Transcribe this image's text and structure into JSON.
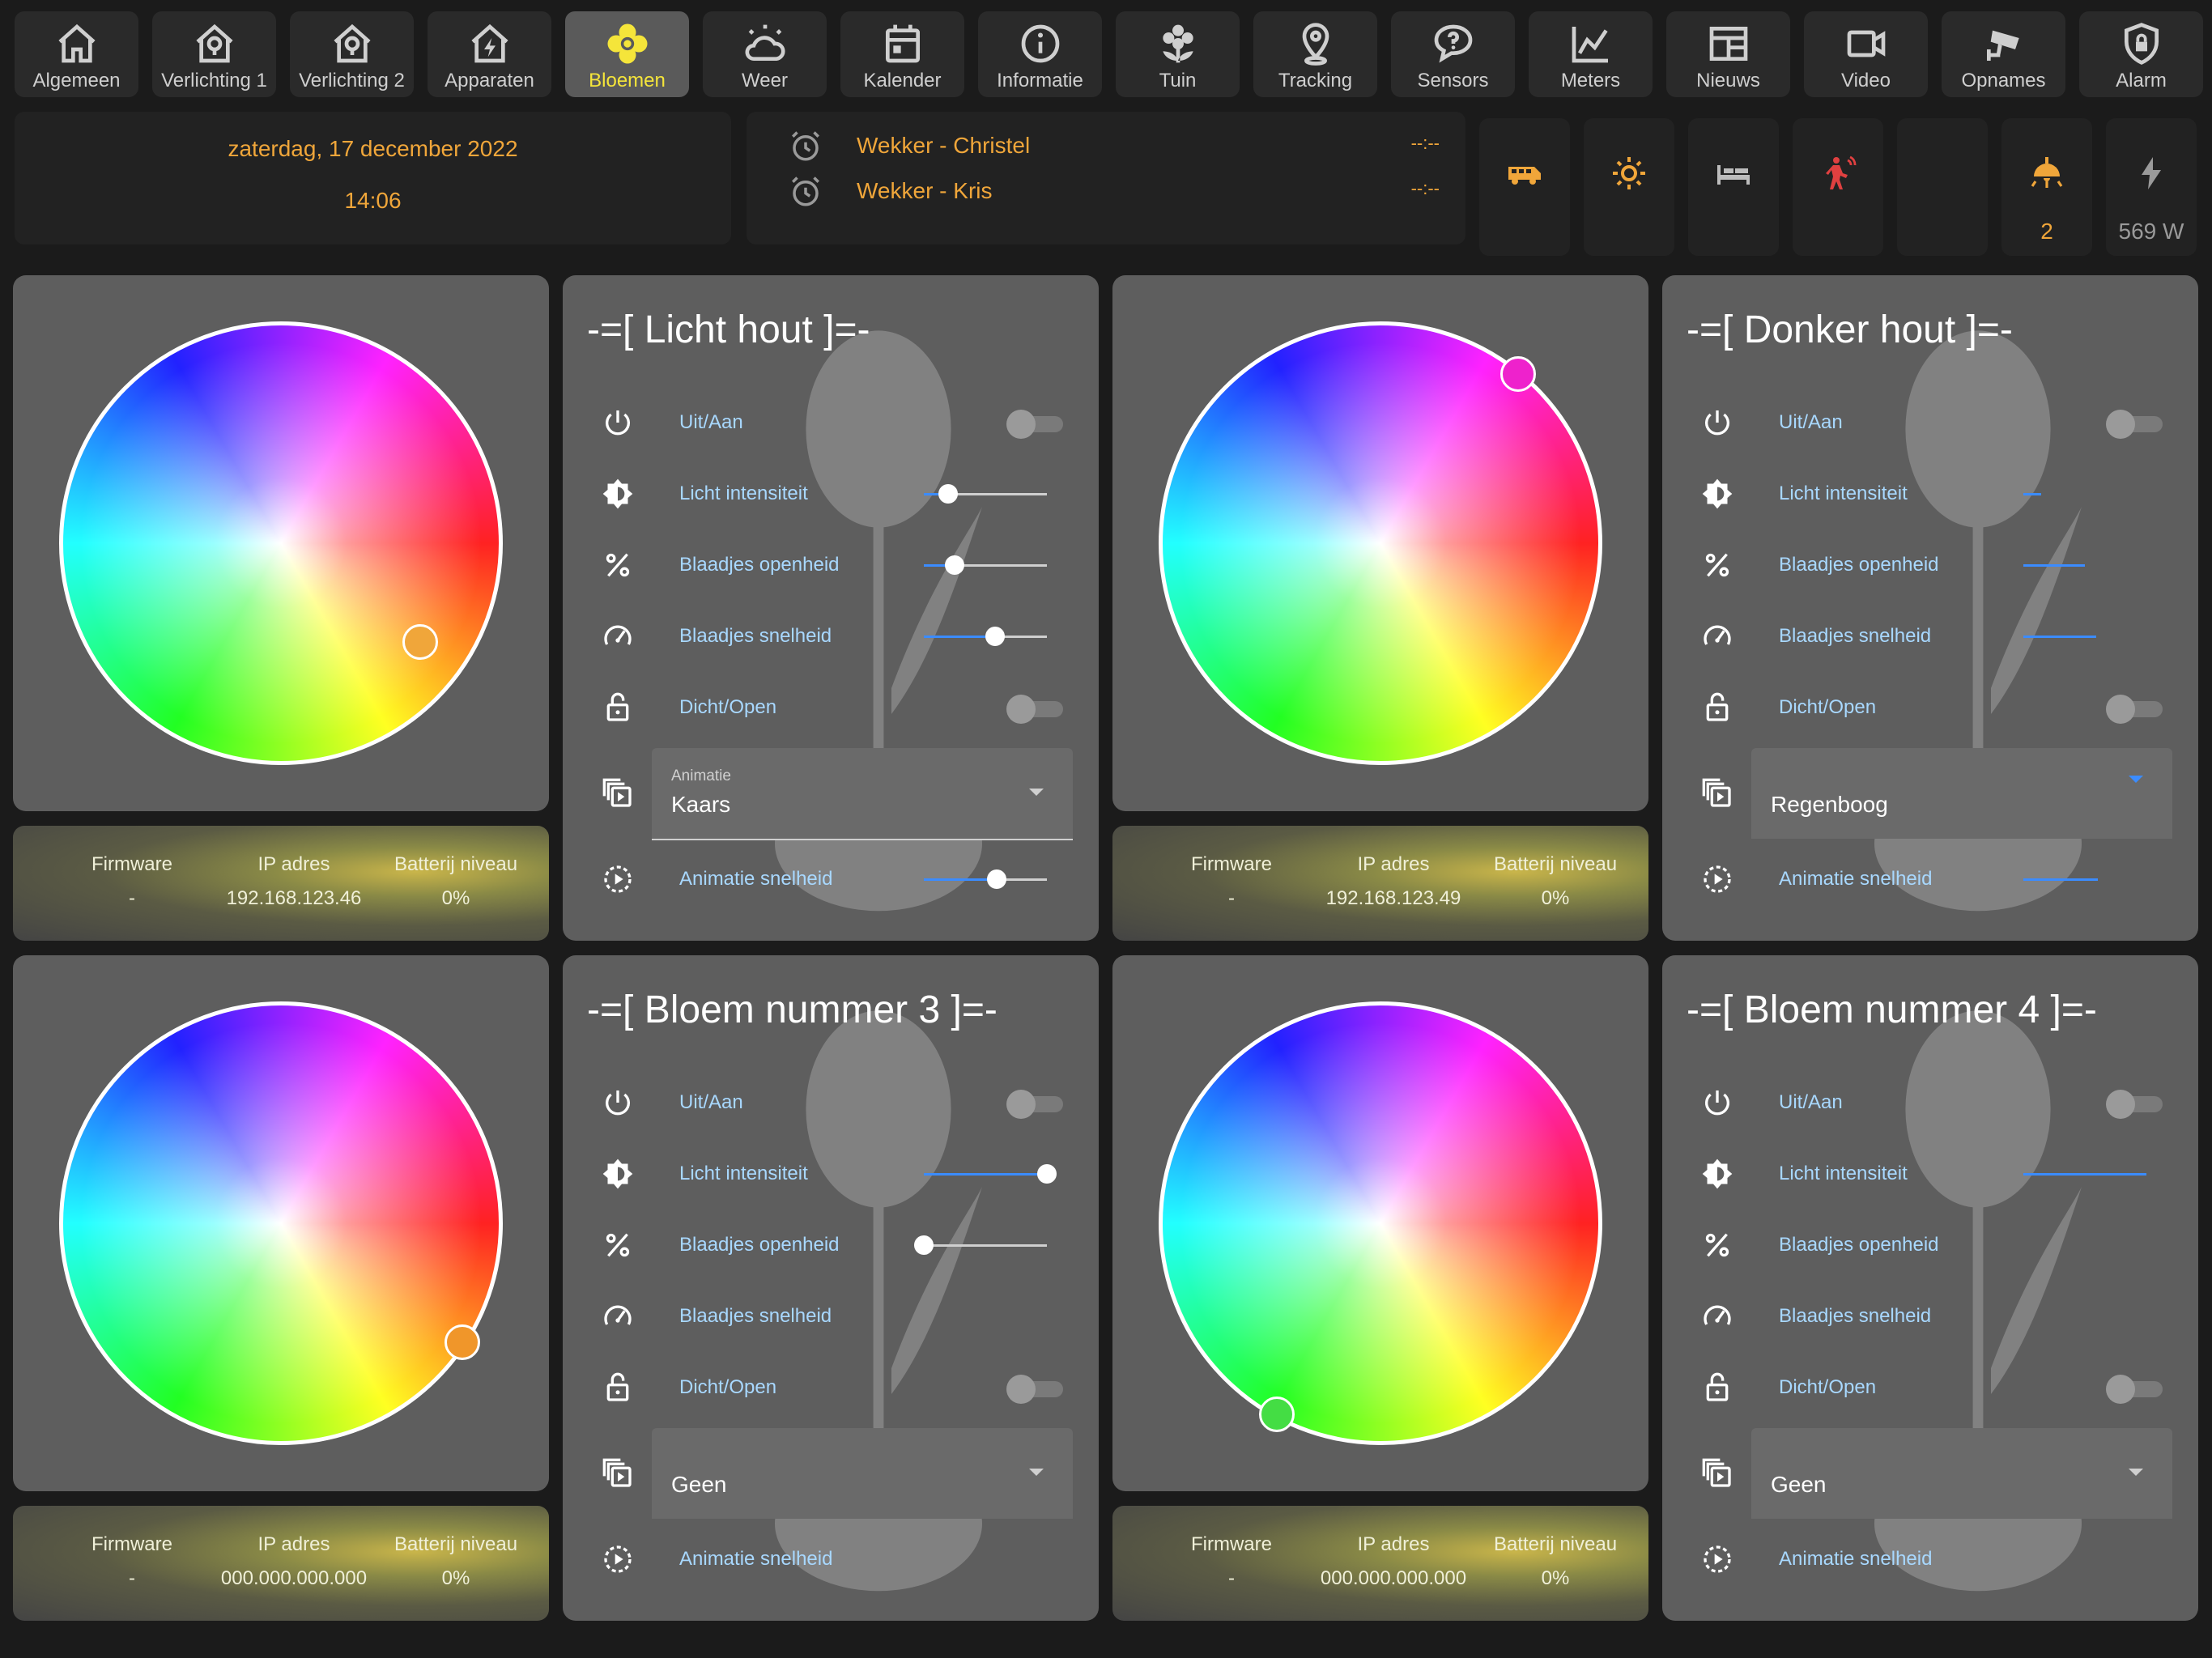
{
  "nav": [
    {
      "label": "Algemeen",
      "icon": "home-icon"
    },
    {
      "label": "Verlichting 1",
      "icon": "home-light-icon"
    },
    {
      "label": "Verlichting 2",
      "icon": "home-light-icon"
    },
    {
      "label": "Apparaten",
      "icon": "home-power-icon"
    },
    {
      "label": "Bloemen",
      "icon": "flower-icon",
      "active": true
    },
    {
      "label": "Weer",
      "icon": "weather-icon"
    },
    {
      "label": "Kalender",
      "icon": "calendar-icon"
    },
    {
      "label": "Informatie",
      "icon": "info-icon"
    },
    {
      "label": "Tuin",
      "icon": "garden-flower-icon"
    },
    {
      "label": "Tracking",
      "icon": "map-pin-icon"
    },
    {
      "label": "Sensors",
      "icon": "chat-question-icon"
    },
    {
      "label": "Meters",
      "icon": "chart-line-icon"
    },
    {
      "label": "Nieuws",
      "icon": "newspaper-icon"
    },
    {
      "label": "Video",
      "icon": "video-camera-icon"
    },
    {
      "label": "Opnames",
      "icon": "cctv-icon"
    },
    {
      "label": "Alarm",
      "icon": "shield-lock-icon"
    }
  ],
  "header": {
    "date": "zaterdag, 17 december 2022",
    "time": "14:06",
    "alarms": [
      {
        "name": "Wekker - Christel",
        "value": "--:--"
      },
      {
        "name": "Wekker - Kris",
        "value": "--:--"
      }
    ],
    "quick_tiles": [
      {
        "icon": "van-icon",
        "color": "#f0a63a",
        "value": ""
      },
      {
        "icon": "sun-icon",
        "color": "#f0a63a",
        "value": ""
      },
      {
        "icon": "bed-icon",
        "color": "#bdbdbd",
        "value": ""
      },
      {
        "icon": "motion-person-icon",
        "color": "#e04040",
        "value": ""
      },
      {
        "icon": "blank-icon",
        "color": "#bdbdbd",
        "value": ""
      },
      {
        "icon": "ceiling-light-icon",
        "color": "#f0a63a",
        "value": "2",
        "value_color": "#f0a63a"
      },
      {
        "icon": "flash-icon",
        "color": "#9a9a9a",
        "value": "569 W",
        "value_color": "#9a9a9a"
      }
    ]
  },
  "info_labels": {
    "firmware": "Firmware",
    "ip": "IP adres",
    "battery": "Batterij niveau"
  },
  "flowers": [
    {
      "title": "-=[ Licht hout ]=-",
      "knob_color": "#f0a63a",
      "firmware": "-",
      "ip": "192.168.123.46",
      "battery": "0%",
      "rows": {
        "power": "Uit/Aan",
        "intensity": "Licht intensiteit",
        "opening": "Blaadjes openheid",
        "speed": "Blaadjes snelheid",
        "close": "Dicht/Open",
        "anim_speed": "Animatie snelheid"
      },
      "intensity": 0.2,
      "opening": 0.25,
      "speed": 0.58,
      "anim_speed": 0.6,
      "animation": {
        "label": "Animatie",
        "value": "Kaars"
      }
    },
    {
      "title": "-=[ Donker hout ]=-",
      "knob_color": "#ee22cc",
      "firmware": "-",
      "ip": "192.168.123.49",
      "battery": "0%",
      "rows": {
        "power": "Uit/Aan",
        "intensity": "Licht intensiteit",
        "opening": "Blaadjes openheid",
        "speed": "Blaadjes snelheid",
        "close": "Dicht/Open",
        "anim_speed": "Animatie snelheid"
      },
      "intensity": 0.15,
      "opening": 0.5,
      "speed": 0.6,
      "anim_speed": 0.6,
      "animation": {
        "label": "",
        "value": "Regenboog"
      }
    },
    {
      "title": "-=[ Bloem nummer 3 ]=-",
      "knob_color": "#f0962a",
      "firmware": "-",
      "ip": "000.000.000.000",
      "battery": "0%",
      "rows": {
        "power": "Uit/Aan",
        "intensity": "Licht intensiteit",
        "opening": "Blaadjes openheid",
        "speed": "Blaadjes snelheid",
        "close": "Dicht/Open",
        "anim_speed": "Animatie snelheid"
      },
      "intensity": 1.0,
      "opening": 0.0,
      "animation": {
        "label": "",
        "value": "Geen"
      }
    },
    {
      "title": "-=[ Bloem nummer 4 ]=-",
      "knob_color": "#44dd44",
      "firmware": "-",
      "ip": "000.000.000.000",
      "battery": "0%",
      "rows": {
        "power": "Uit/Aan",
        "intensity": "Licht intensiteit",
        "opening": "Blaadjes openheid",
        "speed": "Blaadjes snelheid",
        "close": "Dicht/Open",
        "anim_speed": "Animatie snelheid"
      },
      "intensity": 1.0,
      "animation": {
        "label": "",
        "value": "Geen"
      }
    }
  ]
}
